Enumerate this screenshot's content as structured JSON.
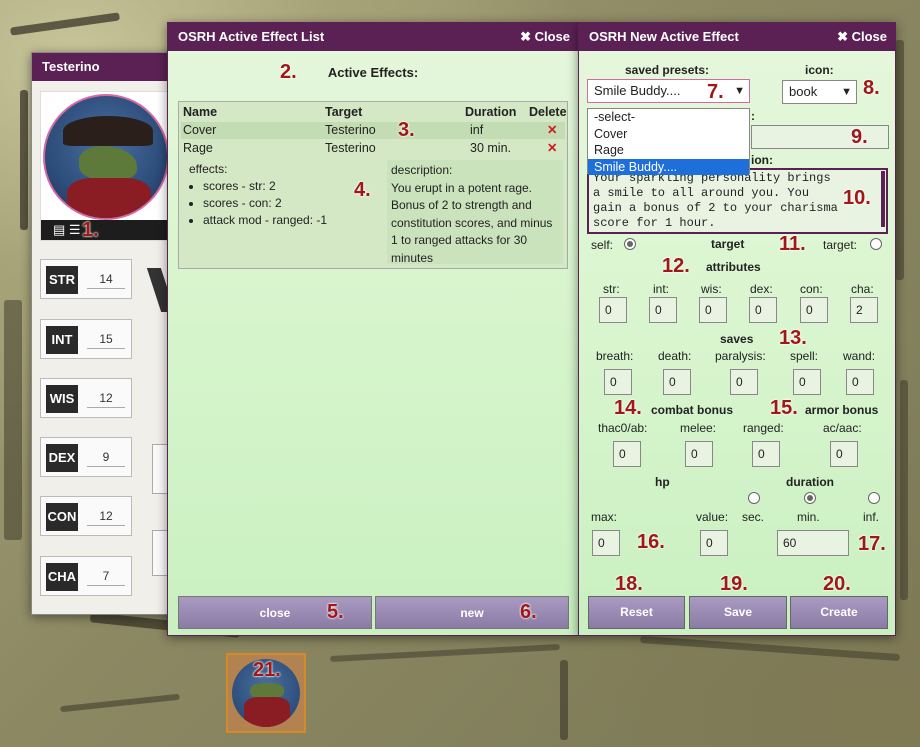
{
  "sheet": {
    "title": "Testerino",
    "stats": [
      {
        "label": "STR",
        "value": "14"
      },
      {
        "label": "INT",
        "value": "15"
      },
      {
        "label": "WIS",
        "value": "12"
      },
      {
        "label": "DEX",
        "value": "9"
      },
      {
        "label": "CON",
        "value": "12"
      },
      {
        "label": "CHA",
        "value": "7"
      }
    ]
  },
  "list": {
    "title": "OSRH Active Effect List",
    "close_label": "Close",
    "heading": "Active Effects:",
    "columns": [
      "Name",
      "Target",
      "Duration",
      "Delete"
    ],
    "rows": [
      {
        "name": "Cover",
        "target": "Testerino",
        "duration": "inf"
      },
      {
        "name": "Rage",
        "target": "Testerino",
        "duration": "30 min."
      }
    ],
    "effects_label": "effects:",
    "effects": [
      "scores - str: 2",
      "scores - con: 2",
      "attack mod - ranged: -1"
    ],
    "description_label": "description:",
    "description": "You erupt in a potent rage. Bonus of 2 to strength and constitution scores, and minus 1 to ranged attacks for 30 minutes",
    "close_button": "close",
    "new_button": "new"
  },
  "neweff": {
    "title": "OSRH New Active Effect",
    "close_label": "Close",
    "presets_label": "saved presets:",
    "preset_selected": "Smile Buddy....",
    "preset_options": [
      "-select-",
      "Cover",
      "Rage",
      "Smile Buddy...."
    ],
    "icon_label": "icon:",
    "icon_selected": "book",
    "name_label_tail": ":",
    "desc_label_tail": "ion:",
    "description": "Your sparkling personality brings\na smile to all around you. You\ngain a bonus of 2 to your charisma\nscore for 1 hour.",
    "target_label": "target",
    "self_label": "self:",
    "target_opt_label": "target:",
    "attributes_label": "attributes",
    "attributes": [
      {
        "label": "str:",
        "value": "0"
      },
      {
        "label": "int:",
        "value": "0"
      },
      {
        "label": "wis:",
        "value": "0"
      },
      {
        "label": "dex:",
        "value": "0"
      },
      {
        "label": "con:",
        "value": "0"
      },
      {
        "label": "cha:",
        "value": "2"
      }
    ],
    "saves_label": "saves",
    "saves": [
      {
        "label": "breath:",
        "value": "0"
      },
      {
        "label": "death:",
        "value": "0"
      },
      {
        "label": "paralysis:",
        "value": "0"
      },
      {
        "label": "spell:",
        "value": "0"
      },
      {
        "label": "wand:",
        "value": "0"
      }
    ],
    "combat_label": "combat bonus",
    "armor_label": "armor bonus",
    "combat": [
      {
        "label": "thac0/ab:",
        "value": "0"
      },
      {
        "label": "melee:",
        "value": "0"
      },
      {
        "label": "ranged:",
        "value": "0"
      },
      {
        "label": "ac/aac:",
        "value": "0"
      }
    ],
    "hp_label": "hp",
    "duration_label": "duration",
    "max_label": "max:",
    "max_value": "0",
    "value_label": "value:",
    "value_value": "0",
    "sec_label": "sec.",
    "min_label": "min.",
    "inf_label": "inf.",
    "duration_value": "60",
    "reset_button": "Reset",
    "save_button": "Save",
    "create_button": "Create"
  },
  "markers": [
    "1.",
    "2.",
    "3.",
    "4.",
    "5.",
    "6.",
    "7.",
    "8.",
    "9.",
    "10.",
    "11.",
    "12.",
    "13.",
    "14.",
    "15.",
    "16.",
    "17.",
    "18.",
    "19.",
    "20.",
    "21."
  ],
  "colors": {
    "titlebar": "#5b2154",
    "panel": "#d9f5cf",
    "button": "#9a8cb3",
    "delete": "#cc1f1f",
    "marker": "#a01717"
  }
}
